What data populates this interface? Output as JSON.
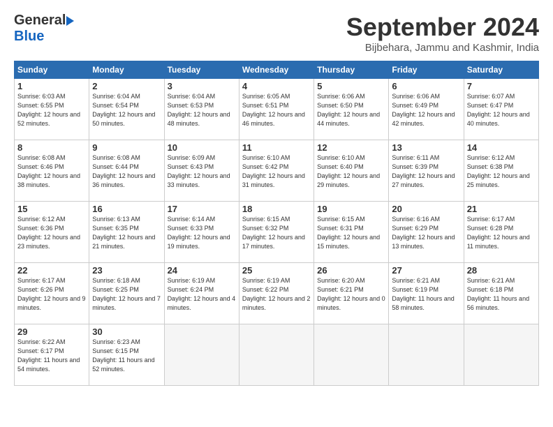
{
  "header": {
    "logo_general": "General",
    "logo_blue": "Blue",
    "title": "September 2024",
    "location": "Bijbehara, Jammu and Kashmir, India"
  },
  "calendar": {
    "days_of_week": [
      "Sunday",
      "Monday",
      "Tuesday",
      "Wednesday",
      "Thursday",
      "Friday",
      "Saturday"
    ],
    "weeks": [
      [
        {
          "day": "1",
          "sunrise": "6:03 AM",
          "sunset": "6:55 PM",
          "daylight": "12 hours and 52 minutes."
        },
        {
          "day": "2",
          "sunrise": "6:04 AM",
          "sunset": "6:54 PM",
          "daylight": "12 hours and 50 minutes."
        },
        {
          "day": "3",
          "sunrise": "6:04 AM",
          "sunset": "6:53 PM",
          "daylight": "12 hours and 48 minutes."
        },
        {
          "day": "4",
          "sunrise": "6:05 AM",
          "sunset": "6:51 PM",
          "daylight": "12 hours and 46 minutes."
        },
        {
          "day": "5",
          "sunrise": "6:06 AM",
          "sunset": "6:50 PM",
          "daylight": "12 hours and 44 minutes."
        },
        {
          "day": "6",
          "sunrise": "6:06 AM",
          "sunset": "6:49 PM",
          "daylight": "12 hours and 42 minutes."
        },
        {
          "day": "7",
          "sunrise": "6:07 AM",
          "sunset": "6:47 PM",
          "daylight": "12 hours and 40 minutes."
        }
      ],
      [
        {
          "day": "8",
          "sunrise": "6:08 AM",
          "sunset": "6:46 PM",
          "daylight": "12 hours and 38 minutes."
        },
        {
          "day": "9",
          "sunrise": "6:08 AM",
          "sunset": "6:44 PM",
          "daylight": "12 hours and 36 minutes."
        },
        {
          "day": "10",
          "sunrise": "6:09 AM",
          "sunset": "6:43 PM",
          "daylight": "12 hours and 33 minutes."
        },
        {
          "day": "11",
          "sunrise": "6:10 AM",
          "sunset": "6:42 PM",
          "daylight": "12 hours and 31 minutes."
        },
        {
          "day": "12",
          "sunrise": "6:10 AM",
          "sunset": "6:40 PM",
          "daylight": "12 hours and 29 minutes."
        },
        {
          "day": "13",
          "sunrise": "6:11 AM",
          "sunset": "6:39 PM",
          "daylight": "12 hours and 27 minutes."
        },
        {
          "day": "14",
          "sunrise": "6:12 AM",
          "sunset": "6:38 PM",
          "daylight": "12 hours and 25 minutes."
        }
      ],
      [
        {
          "day": "15",
          "sunrise": "6:12 AM",
          "sunset": "6:36 PM",
          "daylight": "12 hours and 23 minutes."
        },
        {
          "day": "16",
          "sunrise": "6:13 AM",
          "sunset": "6:35 PM",
          "daylight": "12 hours and 21 minutes."
        },
        {
          "day": "17",
          "sunrise": "6:14 AM",
          "sunset": "6:33 PM",
          "daylight": "12 hours and 19 minutes."
        },
        {
          "day": "18",
          "sunrise": "6:15 AM",
          "sunset": "6:32 PM",
          "daylight": "12 hours and 17 minutes."
        },
        {
          "day": "19",
          "sunrise": "6:15 AM",
          "sunset": "6:31 PM",
          "daylight": "12 hours and 15 minutes."
        },
        {
          "day": "20",
          "sunrise": "6:16 AM",
          "sunset": "6:29 PM",
          "daylight": "12 hours and 13 minutes."
        },
        {
          "day": "21",
          "sunrise": "6:17 AM",
          "sunset": "6:28 PM",
          "daylight": "12 hours and 11 minutes."
        }
      ],
      [
        {
          "day": "22",
          "sunrise": "6:17 AM",
          "sunset": "6:26 PM",
          "daylight": "12 hours and 9 minutes."
        },
        {
          "day": "23",
          "sunrise": "6:18 AM",
          "sunset": "6:25 PM",
          "daylight": "12 hours and 7 minutes."
        },
        {
          "day": "24",
          "sunrise": "6:19 AM",
          "sunset": "6:24 PM",
          "daylight": "12 hours and 4 minutes."
        },
        {
          "day": "25",
          "sunrise": "6:19 AM",
          "sunset": "6:22 PM",
          "daylight": "12 hours and 2 minutes."
        },
        {
          "day": "26",
          "sunrise": "6:20 AM",
          "sunset": "6:21 PM",
          "daylight": "12 hours and 0 minutes."
        },
        {
          "day": "27",
          "sunrise": "6:21 AM",
          "sunset": "6:19 PM",
          "daylight": "11 hours and 58 minutes."
        },
        {
          "day": "28",
          "sunrise": "6:21 AM",
          "sunset": "6:18 PM",
          "daylight": "11 hours and 56 minutes."
        }
      ],
      [
        {
          "day": "29",
          "sunrise": "6:22 AM",
          "sunset": "6:17 PM",
          "daylight": "11 hours and 54 minutes."
        },
        {
          "day": "30",
          "sunrise": "6:23 AM",
          "sunset": "6:15 PM",
          "daylight": "11 hours and 52 minutes."
        },
        null,
        null,
        null,
        null,
        null
      ]
    ]
  }
}
